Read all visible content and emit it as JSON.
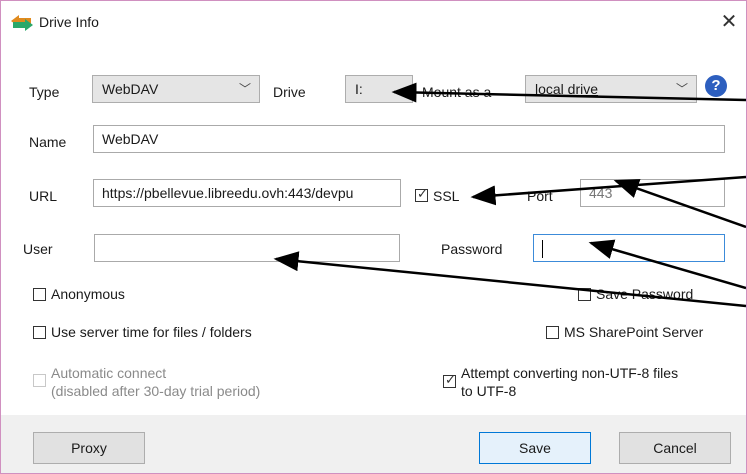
{
  "window": {
    "title": "Drive Info",
    "close_glyph": "✕"
  },
  "labels": {
    "type": "Type",
    "drive": "Drive",
    "mount_as": "Mount as a",
    "name": "Name",
    "url": "URL",
    "port": "Port",
    "user": "User",
    "password": "Password"
  },
  "fields": {
    "type_value": "WebDAV",
    "drive_value": "I:",
    "mount_value": "local drive",
    "name_value": "WebDAV",
    "url_value": "https://pbellevue.libreedu.ovh:443/devpu",
    "port_value": "443",
    "user_value": "",
    "password_value": ""
  },
  "checkboxes": {
    "ssl": {
      "label": "SSL",
      "checked": true
    },
    "anonymous": {
      "label": "Anonymous",
      "checked": false
    },
    "save_password": {
      "label": "Save Password",
      "checked": false
    },
    "server_time": {
      "label": "Use server time for files / folders",
      "checked": false
    },
    "sharepoint": {
      "label": "MS SharePoint Server",
      "checked": false
    },
    "auto_connect": {
      "label": "Automatic connect",
      "note": "(disabled after 30-day trial period)",
      "checked": false,
      "disabled": true
    },
    "utf8_line1": "Attempt converting non-UTF-8 files",
    "utf8_line2": "to UTF-8"
  },
  "buttons": {
    "proxy": "Proxy",
    "save": "Save",
    "cancel": "Cancel",
    "help": "?"
  },
  "icons": {
    "chevron": "chevron-down-icon",
    "app": "arrows-app-icon",
    "help": "help-icon"
  },
  "colors": {
    "help_blue": "#2d5fbf",
    "focus_blue": "#3c8bd9",
    "default_btn": "#0078d7"
  }
}
